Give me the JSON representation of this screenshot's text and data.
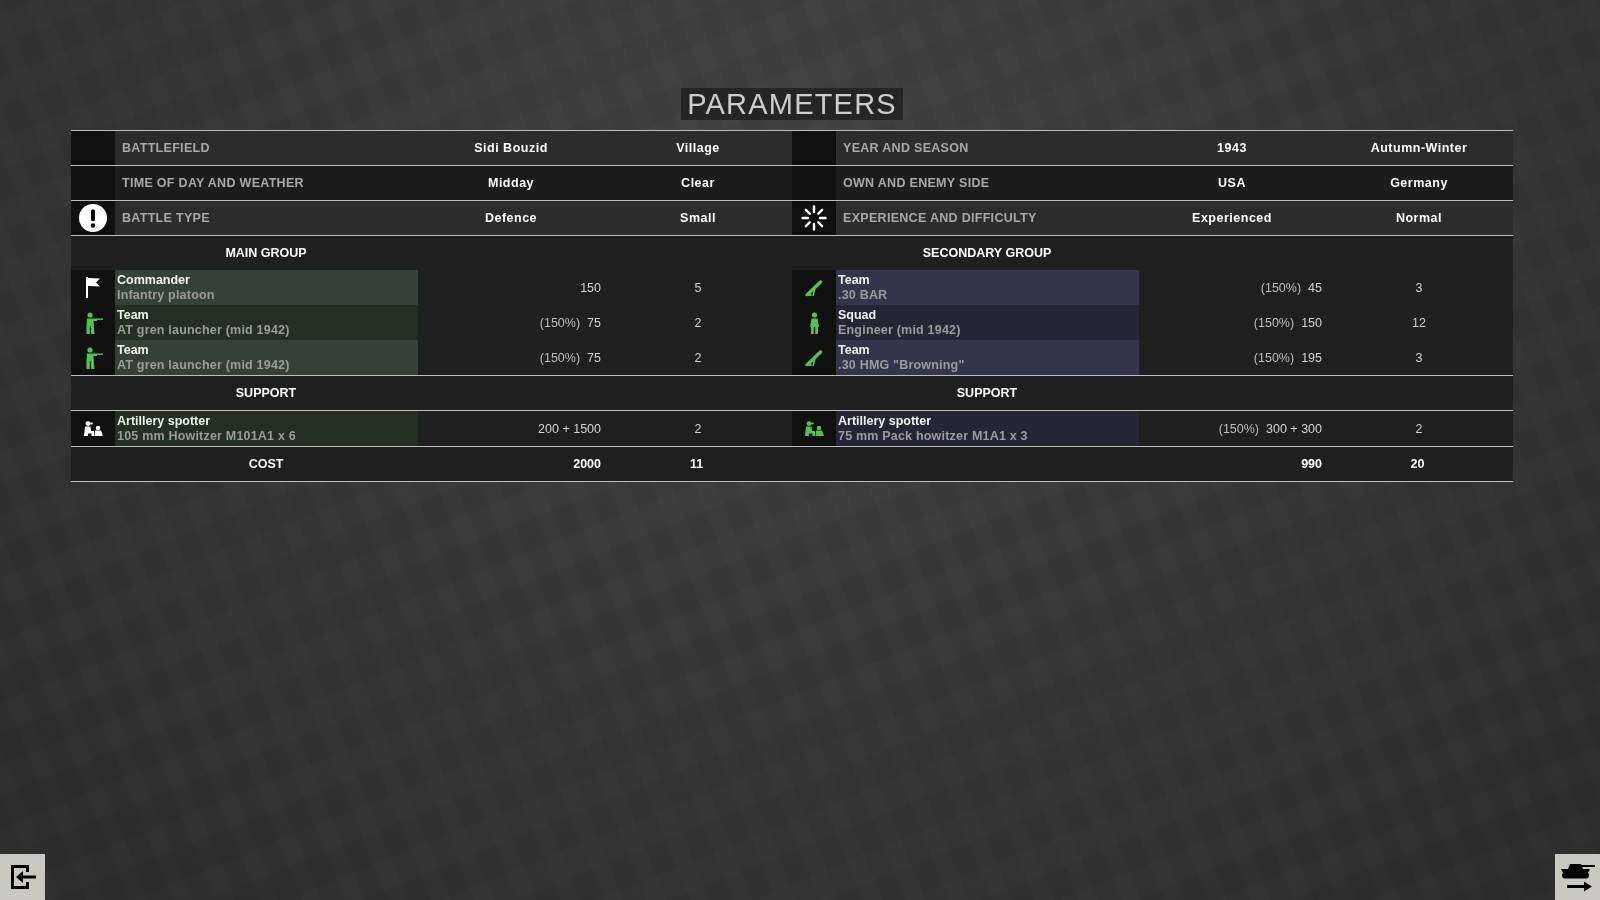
{
  "title": "PARAMETERS",
  "sides": [
    {
      "parameters": [
        {
          "kind": "plain",
          "label": "BATTLEFIELD",
          "value": "Sidi Bouzid",
          "option": "Village"
        },
        {
          "kind": "plain",
          "label": "TIME OF DAY AND WEATHER",
          "value": "Midday",
          "option": "Clear"
        },
        {
          "kind": "alert",
          "label": "BATTLE TYPE",
          "value": "Defence",
          "option": "Small"
        }
      ],
      "group_heading": "MAIN GROUP",
      "units": [
        {
          "kind": "flag",
          "color": "#ffffff",
          "name": "Commander",
          "type": "Infantry platoon",
          "cost": "150",
          "count": "5"
        },
        {
          "kind": "rifleman",
          "color": "#55c155",
          "name": "Team",
          "type": "AT gren launcher (mid 1942)",
          "modifier": "(150%)",
          "cost": "75",
          "count": "2"
        },
        {
          "kind": "rifleman",
          "color": "#55c155",
          "name": "Team",
          "type": "AT gren launcher (mid 1942)",
          "modifier": "(150%)",
          "cost": "75",
          "count": "2"
        }
      ],
      "support_heading": "SUPPORT",
      "support": [
        {
          "kind": "spotter",
          "color": "#ffffff",
          "name": "Artillery spotter",
          "type": "105 mm Howitzer M101A1 x 6",
          "cost": "200 + 1500",
          "count": "2"
        }
      ],
      "cost_label": "COST",
      "total_cost": "2000",
      "total_count": "11"
    },
    {
      "parameters": [
        {
          "kind": "plain",
          "label": "YEAR AND SEASON",
          "value": "1943",
          "option": "Autumn-Winter"
        },
        {
          "kind": "plain",
          "label": "OWN AND ENEMY SIDE",
          "value": "USA",
          "option": "Germany"
        },
        {
          "kind": "progress",
          "label": "EXPERIENCE AND DIFFICULTY",
          "value": "Experienced",
          "option": "Normal"
        }
      ],
      "group_heading": "SECONDARY GROUP",
      "units": [
        {
          "kind": "mortar",
          "color": "#55c155",
          "name": "Team",
          "type": ".30 BAR",
          "modifier": "(150%)",
          "cost": "45",
          "count": "3"
        },
        {
          "kind": "soldier",
          "color": "#55c155",
          "name": "Squad",
          "type": "Engineer (mid 1942)",
          "modifier": "(150%)",
          "cost": "150",
          "count": "12"
        },
        {
          "kind": "mortar",
          "color": "#55c155",
          "name": "Team",
          "type": ".30 HMG \"Browning\"",
          "modifier": "(150%)",
          "cost": "195",
          "count": "3"
        }
      ],
      "support_heading": "SUPPORT",
      "support": [
        {
          "kind": "spotter",
          "color": "#55c155",
          "name": "Artillery spotter",
          "type": "75 mm Pack howitzer M1A1 x 3",
          "modifier": "(150%)",
          "cost": "300 + 300",
          "count": "2"
        }
      ],
      "total_cost": "990",
      "total_count": "20"
    }
  ]
}
